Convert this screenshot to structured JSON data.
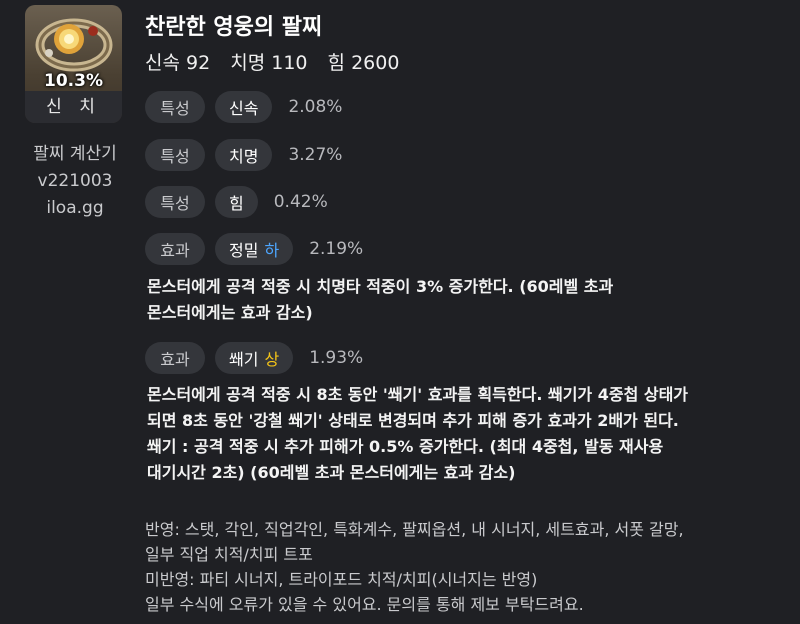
{
  "item": {
    "percent": "10.3%",
    "grade": "신 치",
    "title": "찬란한 영웅의 팔찌"
  },
  "calculator": {
    "name": "팔찌 계산기",
    "version": "v221003",
    "site": "iloa.gg"
  },
  "stats": [
    "신속 92",
    "치명 110",
    "힘 2600"
  ],
  "rows": [
    {
      "category": "특성",
      "name": "신속",
      "level": "",
      "value": "2.08%"
    },
    {
      "category": "특성",
      "name": "치명",
      "level": "",
      "value": "3.27%"
    },
    {
      "category": "특성",
      "name": "힘",
      "level": "",
      "value": "0.42%"
    },
    {
      "category": "효과",
      "name": "정밀",
      "level": "하",
      "value": "2.19%"
    },
    {
      "category": "효과",
      "name": "쐐기",
      "level": "상",
      "value": "1.93%"
    }
  ],
  "effects": {
    "precision_desc": [
      "몬스터에게 공격 적중 시 치명타 적중이 3% 증가한다. (60레벨 초과",
      "몬스터에게는 효과 감소)"
    ],
    "wedge_desc": [
      "몬스터에게 공격 적중 시 8초 동안 '쐐기' 효과를 획득한다. 쐐기가 4중첩 상태가",
      "되면 8초 동안 '강철 쐐기' 상태로 변경되며 추가 피해 증가 효과가 2배가 된다.",
      "쐐기 : 공격 적중 시 추가 피해가 0.5% 증가한다. (최대 4중첩, 발동 재사용",
      "대기시간 2초) (60레벨 초과 몬스터에게는 효과 감소)"
    ]
  },
  "notes": [
    "반영: 스탯, 각인, 직업각인, 특화계수, 팔찌옵션, 내 시너지, 세트효과, 서폿 갈망,",
    "일부 직업 치적/치피 트포",
    "미반영: 파티 시너지, 트라이포드 치적/치피(시너지는 반영)",
    "일부 수식에 오류가 있을 수 있어요. 문의를 통해 제보 부탁드려요."
  ]
}
